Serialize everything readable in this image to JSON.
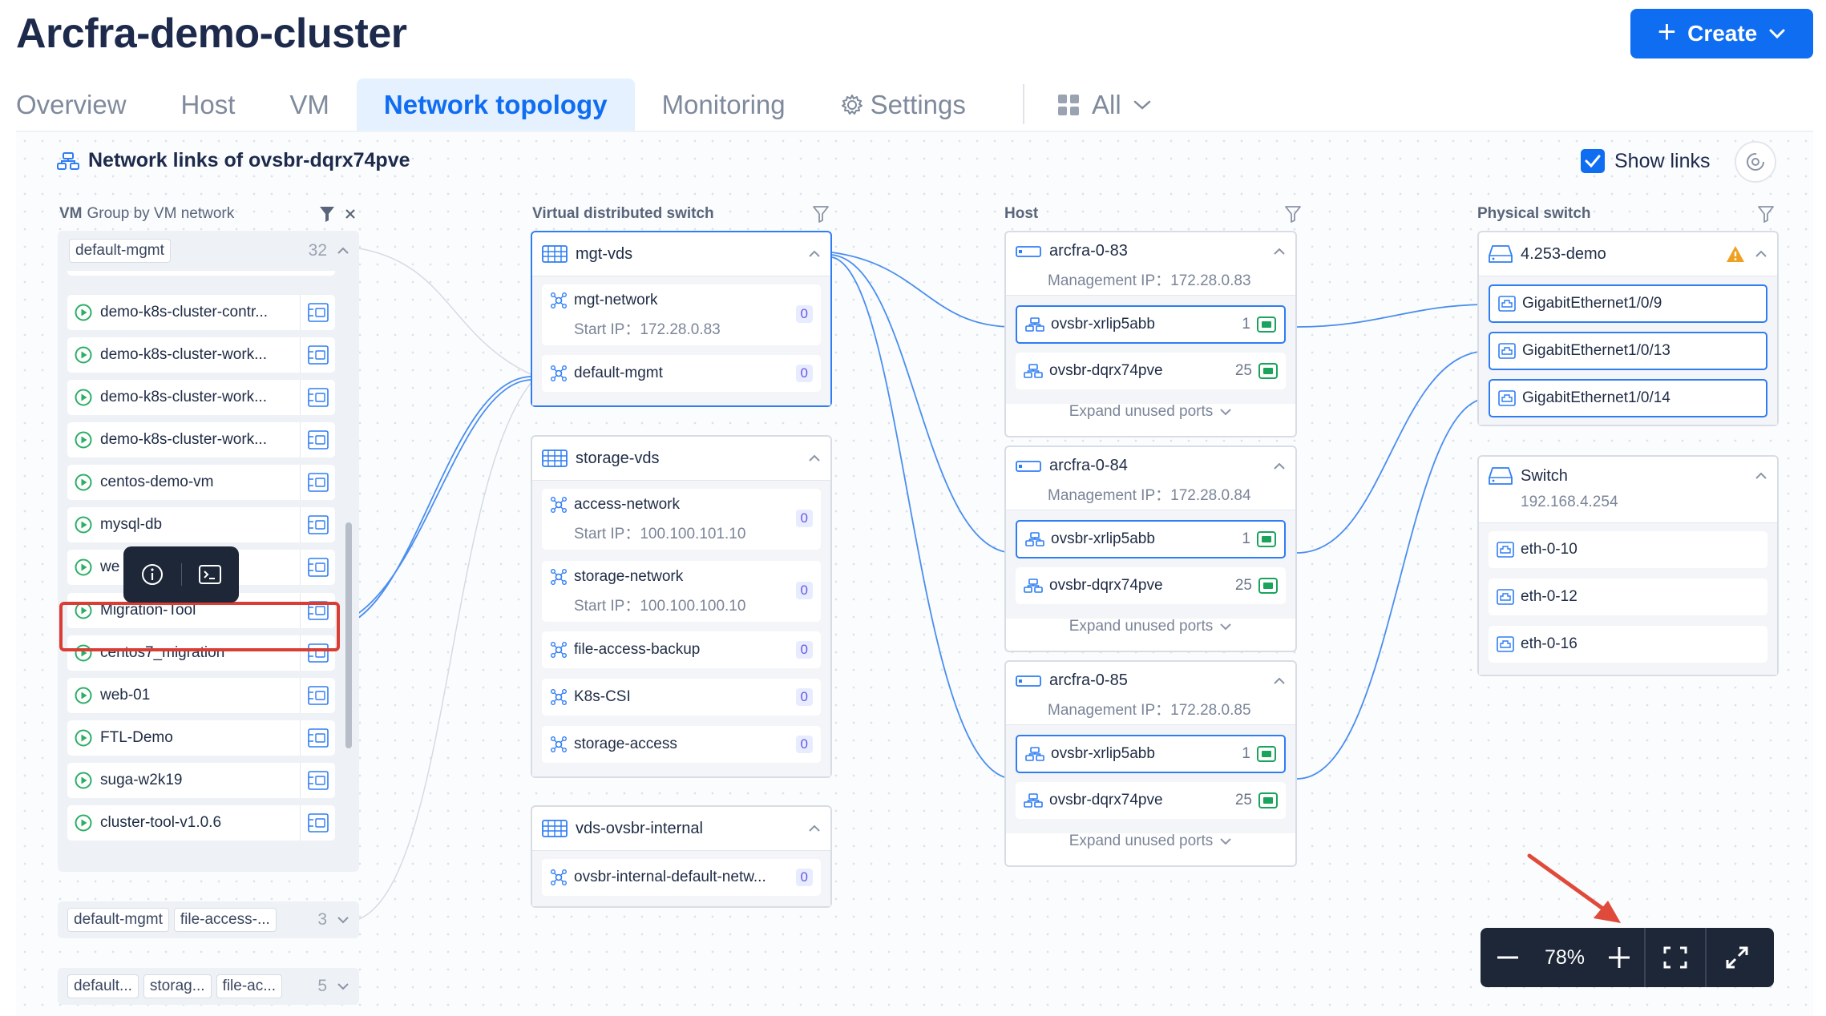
{
  "header": {
    "title": "Arcfra-demo-cluster",
    "create_label": "Create"
  },
  "tabs": [
    {
      "label": "Overview"
    },
    {
      "label": "Host"
    },
    {
      "label": "VM"
    },
    {
      "label": "Network topology",
      "active": true
    },
    {
      "label": "Monitoring"
    },
    {
      "label": "Settings"
    },
    {
      "label": "All"
    }
  ],
  "topology": {
    "title": "Network links of ovsbr-dqrx74pve",
    "show_links_label": "Show links",
    "show_links_checked": true
  },
  "columns": {
    "vm": {
      "label": "VM",
      "sub": "Group by VM network"
    },
    "vds": {
      "label": "Virtual distributed switch"
    },
    "host": {
      "label": "Host"
    },
    "physical": {
      "label": "Physical switch"
    }
  },
  "vm_groups": {
    "g1": {
      "tag": "default-mgmt",
      "count": "32"
    },
    "vms": [
      "demo-k8s-cluster-contr...",
      "demo-k8s-cluster-work...",
      "demo-k8s-cluster-work...",
      "demo-k8s-cluster-work...",
      "centos-demo-vm",
      "mysql-db",
      "we",
      "Migration-Tool",
      "centos7_migration",
      "web-01",
      "FTL-Demo",
      "suga-w2k19",
      "cluster-tool-v1.0.6"
    ],
    "g2": {
      "tags": [
        "default-mgmt",
        "file-access-..."
      ],
      "count": "3"
    },
    "g3": {
      "tags": [
        "default...",
        "storag...",
        "file-ac..."
      ],
      "count": "5"
    }
  },
  "vds": [
    {
      "name": "mgt-vds",
      "networks": [
        {
          "name": "mgt-network",
          "start_ip_label": "Start IP：",
          "start_ip": "172.28.0.83",
          "count": "0"
        },
        {
          "name": "default-mgmt",
          "count": "0"
        }
      ]
    },
    {
      "name": "storage-vds",
      "networks": [
        {
          "name": "access-network",
          "start_ip_label": "Start IP：",
          "start_ip": "100.100.101.10",
          "count": "0"
        },
        {
          "name": "storage-network",
          "start_ip_label": "Start IP：",
          "start_ip": "100.100.100.10",
          "count": "0"
        },
        {
          "name": "file-access-backup",
          "count": "0"
        },
        {
          "name": "K8s-CSI",
          "count": "0"
        },
        {
          "name": "storage-access",
          "count": "0"
        }
      ]
    },
    {
      "name": "vds-ovsbr-internal",
      "networks": [
        {
          "name": "ovsbr-internal-default-netw...",
          "count": "0"
        }
      ]
    }
  ],
  "hosts": [
    {
      "name": "arcfra-0-83",
      "mgmt_label": "Management IP：",
      "mgmt_ip": "172.28.0.83",
      "ports": [
        {
          "name": "ovsbr-xrlip5abb",
          "count": "1"
        },
        {
          "name": "ovsbr-dqrx74pve",
          "count": "25"
        }
      ],
      "expand": "Expand unused ports"
    },
    {
      "name": "arcfra-0-84",
      "mgmt_label": "Management IP：",
      "mgmt_ip": "172.28.0.84",
      "ports": [
        {
          "name": "ovsbr-xrlip5abb",
          "count": "1"
        },
        {
          "name": "ovsbr-dqrx74pve",
          "count": "25"
        }
      ],
      "expand": "Expand unused ports"
    },
    {
      "name": "arcfra-0-85",
      "mgmt_label": "Management IP：",
      "mgmt_ip": "172.28.0.85",
      "ports": [
        {
          "name": "ovsbr-xrlip5abb",
          "count": "1"
        },
        {
          "name": "ovsbr-dqrx74pve",
          "count": "25"
        }
      ],
      "expand": "Expand unused ports"
    }
  ],
  "switches": [
    {
      "name": "4.253-demo",
      "ports": [
        "GigabitEthernet1/0/9",
        "GigabitEthernet1/0/13",
        "GigabitEthernet1/0/14"
      ]
    },
    {
      "name": "Switch",
      "ip": "192.168.4.254",
      "ports": [
        "eth-0-10",
        "eth-0-12",
        "eth-0-16"
      ]
    }
  ],
  "zoom": {
    "value": "78%"
  },
  "colors": {
    "accent": "#0f6df2",
    "link": "#4a8ef0",
    "highlight": "#d93d33",
    "warning": "#f0a020"
  }
}
